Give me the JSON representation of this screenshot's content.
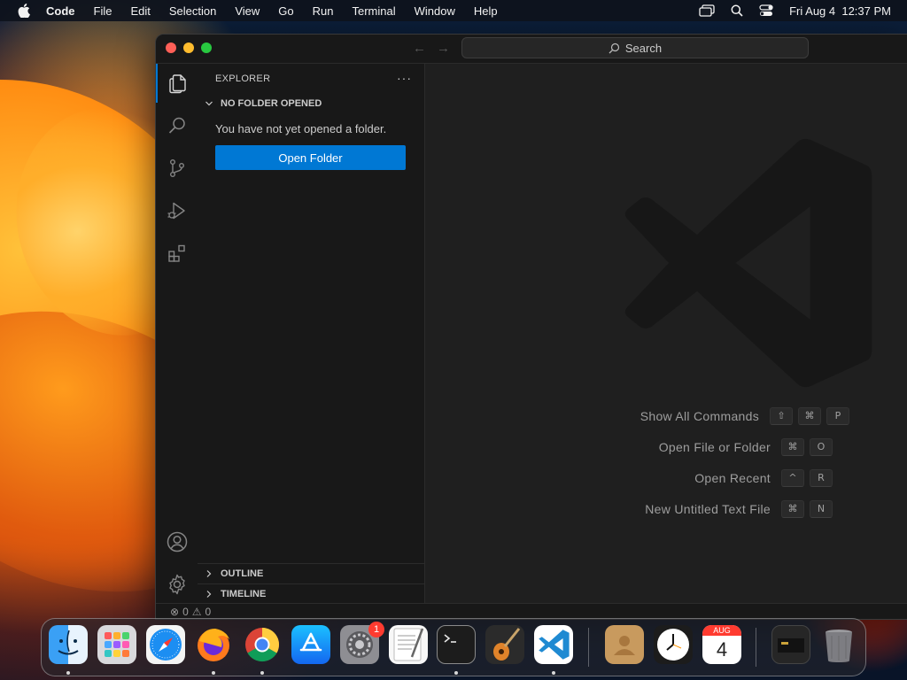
{
  "menubar": {
    "app_name": "Code",
    "items": [
      "File",
      "Edit",
      "Selection",
      "View",
      "Go",
      "Run",
      "Terminal",
      "Window",
      "Help"
    ],
    "datetime": "Fri Aug 4  12:37 PM"
  },
  "window": {
    "search_label": "Search"
  },
  "sidebar": {
    "title": "EXPLORER",
    "more": "···",
    "section": "NO FOLDER OPENED",
    "message": "You have not yet opened a folder.",
    "open_folder": "Open Folder",
    "outline": "OUTLINE",
    "timeline": "TIMELINE"
  },
  "editor": {
    "shortcuts": [
      {
        "label": "Show All Commands",
        "keys": [
          "⇧",
          "⌘",
          "P"
        ]
      },
      {
        "label": "Open File or Folder",
        "keys": [
          "⌘",
          "O"
        ]
      },
      {
        "label": "Open Recent",
        "keys": [
          "^",
          "R"
        ]
      },
      {
        "label": "New Untitled Text File",
        "keys": [
          "⌘",
          "N"
        ]
      }
    ]
  },
  "statusbar": {
    "errors": "0",
    "warnings": "0"
  },
  "dock": {
    "settings_badge": "1",
    "calendar_month": "AUG",
    "calendar_day": "4"
  },
  "colors": {
    "accent": "#0078d4",
    "background": "#1f1f1f"
  }
}
